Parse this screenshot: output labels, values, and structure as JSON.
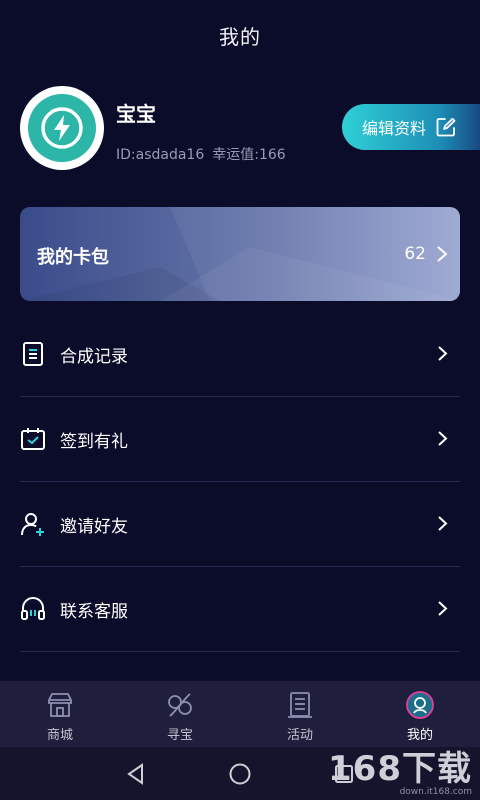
{
  "header": {
    "title": "我的"
  },
  "profile": {
    "name": "宝宝",
    "id_text": "ID:asdada16",
    "luck_text": "幸运值:166",
    "edit_label": "编辑资料"
  },
  "wallet": {
    "title": "我的卡包",
    "count": "62"
  },
  "menu": [
    {
      "label": "合成记录",
      "icon": "document-icon"
    },
    {
      "label": "签到有礼",
      "icon": "calendar-check-icon"
    },
    {
      "label": "邀请好友",
      "icon": "add-user-icon"
    },
    {
      "label": "联系客服",
      "icon": "headset-icon"
    }
  ],
  "tabbar": [
    {
      "label": "商城",
      "icon": "store-icon",
      "active": false
    },
    {
      "label": "寻宝",
      "icon": "treasure-icon",
      "active": false
    },
    {
      "label": "活动",
      "icon": "activity-icon",
      "active": false
    },
    {
      "label": "我的",
      "icon": "profile-icon",
      "active": true
    }
  ],
  "watermark": {
    "text": "168下载",
    "url": "down.it168.com"
  },
  "colors": {
    "background": "#0b0b2a",
    "accent": "#2fd0d6",
    "tabbar": "#1f1e3c"
  }
}
